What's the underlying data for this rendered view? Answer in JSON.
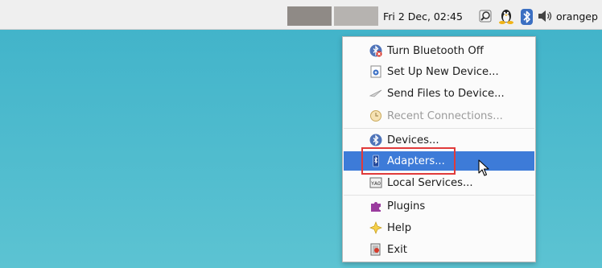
{
  "panel": {
    "clock": "Fri  2 Dec, 02:45",
    "user": "orangep",
    "tray_icons": [
      "magnifier-icon",
      "tux-penguin-icon",
      "bluetooth-icon",
      "volume-icon"
    ]
  },
  "menu": {
    "items": [
      {
        "label": "Turn Bluetooth Off",
        "icon": "bluetooth-off-icon",
        "state": "normal"
      },
      {
        "label": "Set Up New Device...",
        "icon": "new-device-icon",
        "state": "normal"
      },
      {
        "label": "Send Files to Device...",
        "icon": "send-files-icon",
        "state": "normal"
      },
      {
        "label": "Recent Connections...",
        "icon": "recent-clock-icon",
        "state": "disabled"
      },
      {
        "label": "Devices...",
        "icon": "bluetooth-icon",
        "state": "normal"
      },
      {
        "label": "Adapters...",
        "icon": "adapter-icon",
        "state": "selected"
      },
      {
        "label": "Local Services...",
        "icon": "local-services-icon",
        "state": "normal"
      },
      {
        "label": "Plugins",
        "icon": "puzzle-icon",
        "state": "normal"
      },
      {
        "label": "Help",
        "icon": "help-icon",
        "state": "normal"
      },
      {
        "label": "Exit",
        "icon": "exit-icon",
        "state": "normal"
      }
    ]
  },
  "colors": {
    "desktop": "#4ab9cc",
    "selection": "#3d7bd8",
    "highlight_box": "#e03a3a"
  }
}
